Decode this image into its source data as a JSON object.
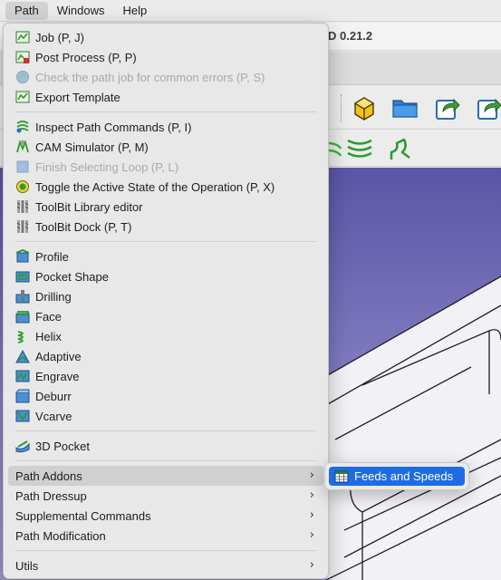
{
  "menubar": {
    "items": [
      {
        "label": "Path",
        "active": true
      },
      {
        "label": "Windows",
        "active": false
      },
      {
        "label": "Help",
        "active": false
      }
    ]
  },
  "app": {
    "title_fragment": "D 0.21.2"
  },
  "path_menu": {
    "groups": [
      [
        {
          "label": "Job (P, J)",
          "icon": "job-icon",
          "enabled": true
        },
        {
          "label": "Post Process (P, P)",
          "icon": "post-process-icon",
          "enabled": true
        },
        {
          "label": "Check the path job for common errors (P, S)",
          "icon": "check-job-icon",
          "enabled": false
        },
        {
          "label": "Export Template",
          "icon": "export-template-icon",
          "enabled": true
        }
      ],
      [
        {
          "label": "Inspect Path Commands (P, I)",
          "icon": "inspect-icon",
          "enabled": true
        },
        {
          "label": "CAM Simulator (P, M)",
          "icon": "simulator-icon",
          "enabled": true
        },
        {
          "label": "Finish Selecting Loop (P, L)",
          "icon": "select-loop-icon",
          "enabled": false
        },
        {
          "label": "Toggle the Active State of the Operation (P, X)",
          "icon": "toggle-active-icon",
          "enabled": true
        },
        {
          "label": "ToolBit Library editor",
          "icon": "toolbit-library-icon",
          "enabled": true
        },
        {
          "label": "ToolBit Dock (P, T)",
          "icon": "toolbit-dock-icon",
          "enabled": true
        }
      ],
      [
        {
          "label": "Profile",
          "icon": "profile-icon",
          "enabled": true
        },
        {
          "label": "Pocket Shape",
          "icon": "pocket-shape-icon",
          "enabled": true
        },
        {
          "label": "Drilling",
          "icon": "drilling-icon",
          "enabled": true
        },
        {
          "label": "Face",
          "icon": "face-icon",
          "enabled": true
        },
        {
          "label": "Helix",
          "icon": "helix-icon",
          "enabled": true
        },
        {
          "label": "Adaptive",
          "icon": "adaptive-icon",
          "enabled": true
        },
        {
          "label": "Engrave",
          "icon": "engrave-icon",
          "enabled": true
        },
        {
          "label": "Deburr",
          "icon": "deburr-icon",
          "enabled": true
        },
        {
          "label": "Vcarve",
          "icon": "vcarve-icon",
          "enabled": true
        }
      ],
      [
        {
          "label": "3D Pocket",
          "icon": "3d-pocket-icon",
          "enabled": true
        }
      ]
    ],
    "submenus": [
      {
        "label": "Path Addons",
        "highlighted": true
      },
      {
        "label": "Path Dressup",
        "highlighted": false
      },
      {
        "label": "Supplemental Commands",
        "highlighted": false
      },
      {
        "label": "Path Modification",
        "highlighted": false
      }
    ],
    "utils": {
      "label": "Utils"
    }
  },
  "addons_submenu": {
    "items": [
      {
        "label": "Feeds and Speeds",
        "icon": "feeds-speeds-icon"
      }
    ]
  },
  "colors": {
    "accent": "#1d6ce3",
    "menu_bg": "#e8e8e8",
    "highlight": "#d0d0d0",
    "disabled_text": "#a9a9a9",
    "viewport_top": "#5b55a6",
    "viewport_bottom": "#9c98cc"
  }
}
